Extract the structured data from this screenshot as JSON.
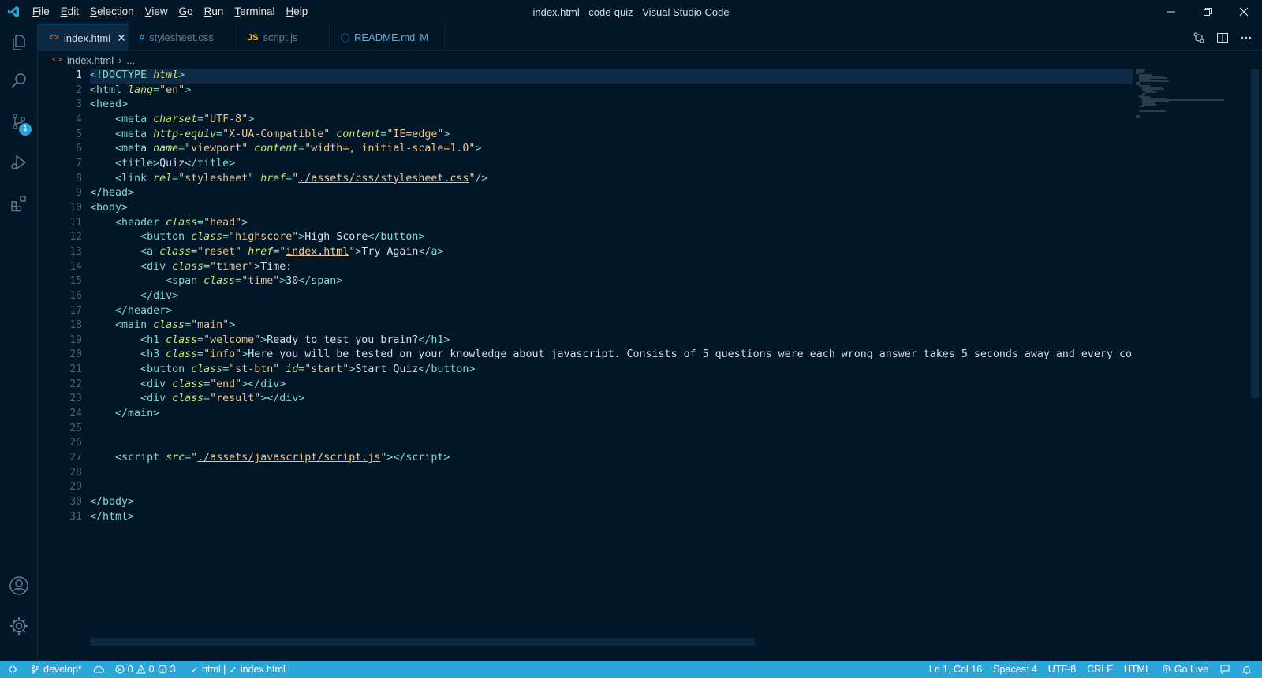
{
  "window": {
    "title": "index.html - code-quiz - Visual Studio Code"
  },
  "menu": [
    "File",
    "Edit",
    "Selection",
    "View",
    "Go",
    "Run",
    "Terminal",
    "Help"
  ],
  "activity": {
    "source_control_badge": "1"
  },
  "tabs": [
    {
      "label": "index.html",
      "icon": "<>",
      "active": true
    },
    {
      "label": "stylesheet.css",
      "icon": "#",
      "active": false
    },
    {
      "label": "script.js",
      "icon": "JS",
      "active": false
    },
    {
      "label": "README.md",
      "icon": "ⓘ",
      "modified": "M",
      "active": false
    }
  ],
  "breadcrumb": {
    "file": "index.html",
    "rest": "..."
  },
  "editor": {
    "current_line": 1,
    "line_numbers": [
      "1",
      "2",
      "3",
      "4",
      "5",
      "6",
      "7",
      "8",
      "9",
      "10",
      "11",
      "12",
      "13",
      "14",
      "15",
      "16",
      "17",
      "18",
      "19",
      "20",
      "21",
      "22",
      "23",
      "24",
      "25",
      "26",
      "27",
      "28",
      "29",
      "30",
      "31"
    ]
  },
  "statusbar": {
    "branch": "develop*",
    "errors": "0",
    "warnings": "0",
    "info": "3",
    "validator": "html | ",
    "validator_file": "index.html",
    "position": "Ln 1, Col 16",
    "spaces": "Spaces: 4",
    "encoding": "UTF-8",
    "eol": "CRLF",
    "language": "HTML",
    "golive": "Go Live"
  },
  "colors": {
    "background": "#011627",
    "statusbar": "#2aa6d8",
    "tag": "#7fdbca",
    "attribute": "#c5e478",
    "string": "#ecc48d",
    "text": "#d6deeb"
  }
}
